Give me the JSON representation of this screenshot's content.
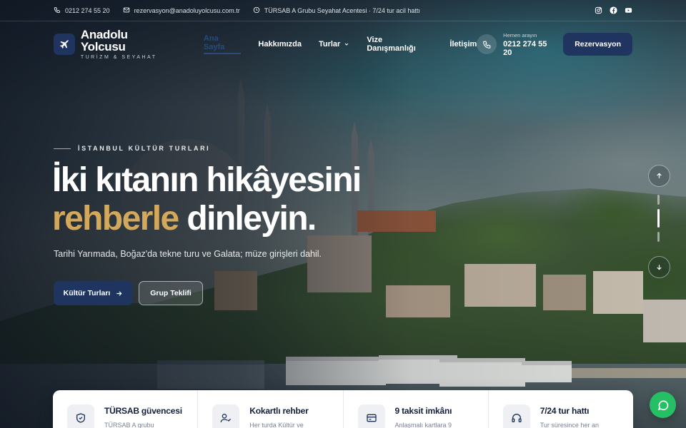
{
  "topbar": {
    "phone": "0212 274 55 20",
    "email": "rezervasyon@anadoluyolcusu.com.tr",
    "info": "TÜRSAB A Grubu Seyahat Acentesi · 7/24 tur acil hattı",
    "socials": [
      "instagram-icon",
      "facebook-icon",
      "youtube-icon"
    ]
  },
  "brand": {
    "name": "Anadolu Yolcusu",
    "tagline": "TURİZM & SEYAHAT",
    "accent": "#1f3560",
    "gold": "#d4a85a"
  },
  "nav": {
    "items": [
      {
        "label": "Ana Sayfa",
        "active": true
      },
      {
        "label": "Hakkımızda"
      },
      {
        "label": "Turlar",
        "dropdown": true
      },
      {
        "label": "Vize Danışmanlığı"
      },
      {
        "label": "İletişim"
      }
    ],
    "call_label": "Hemen arayın",
    "call_number": "0212 274 55 20",
    "reserve_label": "Rezervasyon"
  },
  "hero": {
    "eyebrow": "İSTANBUL KÜLTÜR TURLARI",
    "headline_line1": "İki kıtanın hikâyesini",
    "headline_gold": "rehberle",
    "headline_rest": " dinleyin.",
    "subtitle": "Tarihi Yarımada, Boğaz'da tekne turu ve Galata; müze girişleri dahil.",
    "primary_cta": "Kültür Turları",
    "secondary_cta": "Grup Teklifi"
  },
  "slider": {
    "total": 3,
    "active": 2
  },
  "features": [
    {
      "title": "TÜRSAB güvencesi",
      "desc": "TÜRSAB A grubu",
      "icon": "shield-check-icon"
    },
    {
      "title": "Kokartlı rehber",
      "desc": "Her turda Kültür ve",
      "icon": "user-check-icon"
    },
    {
      "title": "9 taksit imkânı",
      "desc": "Anlaşmalı kartlara 9",
      "icon": "credit-card-icon"
    },
    {
      "title": "7/24 tur hattı",
      "desc": "Tur süresince her an",
      "icon": "headset-icon"
    }
  ]
}
